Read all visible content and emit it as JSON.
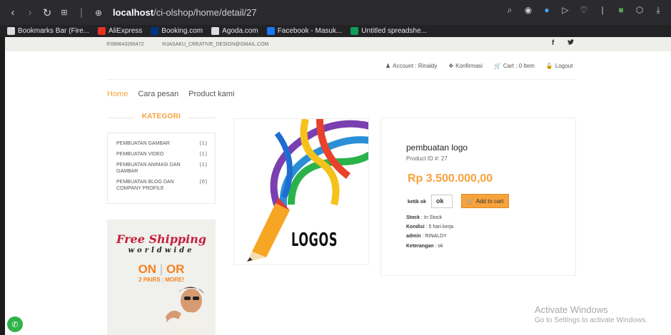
{
  "browser": {
    "url_host": "localhost",
    "url_path": "/ci-olshop/home/detail/27",
    "bookmarks": [
      {
        "label": "Bookmarks Bar (Fire...",
        "color": "#dcdcdc"
      },
      {
        "label": "AliExpress",
        "color": "#e43225"
      },
      {
        "label": "Booking.com",
        "color": "#003580"
      },
      {
        "label": "Agoda.com",
        "color": "#dddddd"
      },
      {
        "label": "Facebook - Masuk...",
        "color": "#1877f2"
      },
      {
        "label": "Untitled spreadshe...",
        "color": "#0f9d58"
      }
    ]
  },
  "topbar": {
    "phone": "089643266472",
    "email": "JASAKU_CREATIVE_DESIGN@GMAIL.COM",
    "facebook": "f",
    "twitter": "🐦"
  },
  "account_nav": {
    "account": "Account : Rinaldy",
    "konfirmasi": "Konfirmasi",
    "cart": "Cart : 0 Item",
    "logout": "Logout"
  },
  "main_nav": [
    "Home",
    "Cara pesan",
    "Product kami"
  ],
  "kategori": {
    "title": "KATEGORI",
    "items": [
      {
        "name": "PEMBUATAN GAMBAR",
        "count": "(1)"
      },
      {
        "name": "PEMBUATAN VIDEO",
        "count": "(1)"
      },
      {
        "name": "PEMBUATAN ANIMASI DAN GAMBAR",
        "count": "(1)"
      },
      {
        "name": "PEMBUATAN BLOG DAN COMPANY PROFILE",
        "count": "(0)"
      }
    ]
  },
  "ad": {
    "free": "Free Shipping",
    "world": "worldwide",
    "on": "ON",
    "or": "OR",
    "pairs": "2 PAIRS",
    "more": "MORE!"
  },
  "product": {
    "image_text": "LOGOS",
    "title": "pembuatan logo",
    "id_label": "Product ID #: 27",
    "price": "Rp 3.500.000,00",
    "qty_label": "ketik ok",
    "qty_value": "ok",
    "add_to_cart": "Add to cart",
    "stock_label": "Stock",
    "stock_value": " : In Stock",
    "kondisi_label": "Kondisi",
    "kondisi_value": " : 5 hari kerja",
    "admin_label": "admin",
    "admin_value": " : RINALDY",
    "keterangan_label": "Keterangan",
    "keterangan_value": " : ok"
  },
  "windows": {
    "title": "Activate Windows",
    "subtitle": "Go to Settings to activate Windows."
  }
}
